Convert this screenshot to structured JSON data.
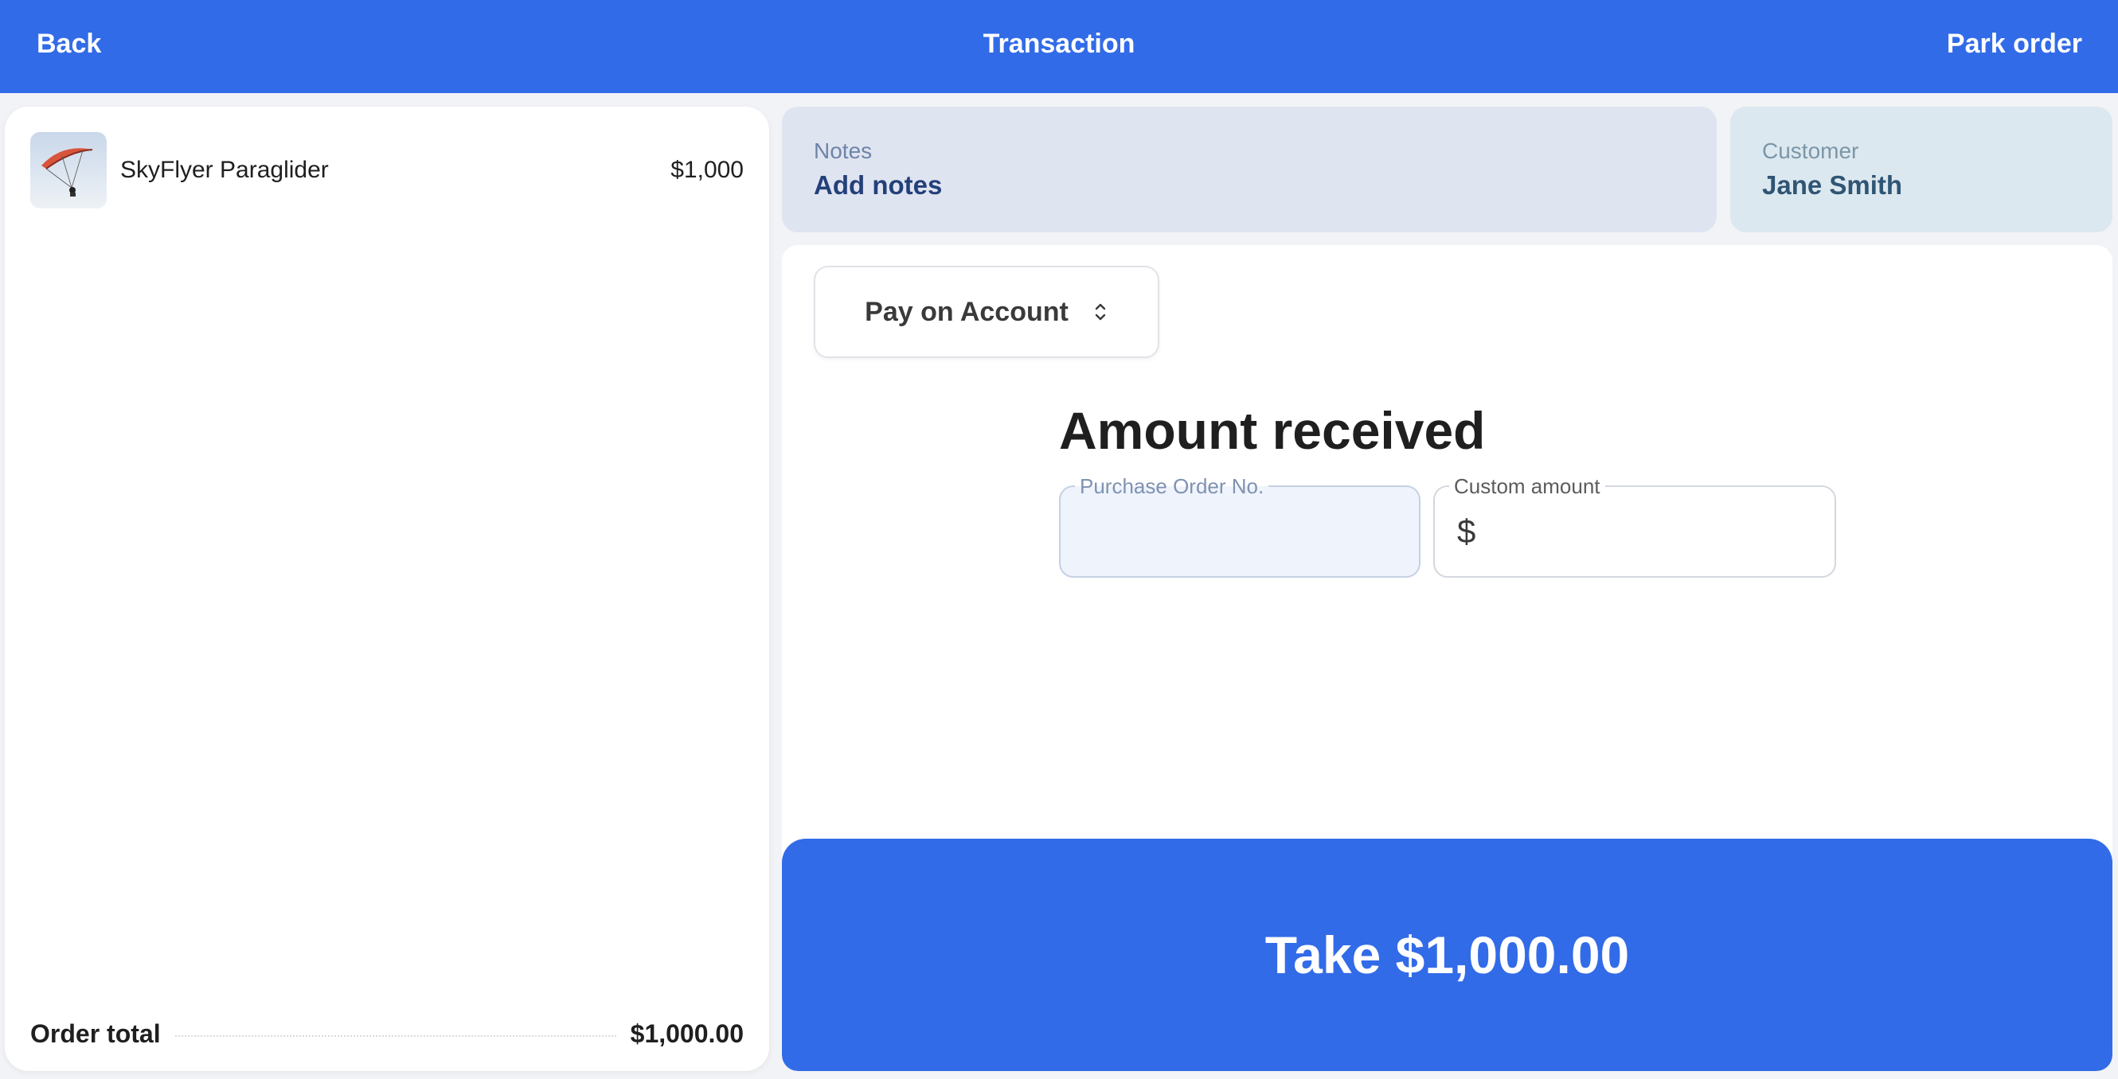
{
  "header": {
    "back_label": "Back",
    "title": "Transaction",
    "park_label": "Park order"
  },
  "order": {
    "items": [
      {
        "name": "SkyFlyer Paraglider",
        "price": "$1,000",
        "thumbnail_icon": "paraglider-photo"
      }
    ],
    "total_label": "Order total",
    "total_value": "$1,000.00"
  },
  "notes": {
    "label": "Notes",
    "value": "Add notes"
  },
  "customer": {
    "label": "Customer",
    "value": "Jane Smith"
  },
  "payment": {
    "method_selected": "Pay on Account",
    "method_icon": "chevron-up-down-icon",
    "amount_title": "Amount received",
    "po_label": "Purchase Order No.",
    "po_value": "",
    "custom_label": "Custom amount",
    "custom_currency": "$",
    "custom_value": ""
  },
  "take_button_label": "Take $1,000.00",
  "colors": {
    "brand_blue": "#326be8",
    "notes_bg": "#dfe4f1",
    "customer_bg": "#dce8ef"
  }
}
